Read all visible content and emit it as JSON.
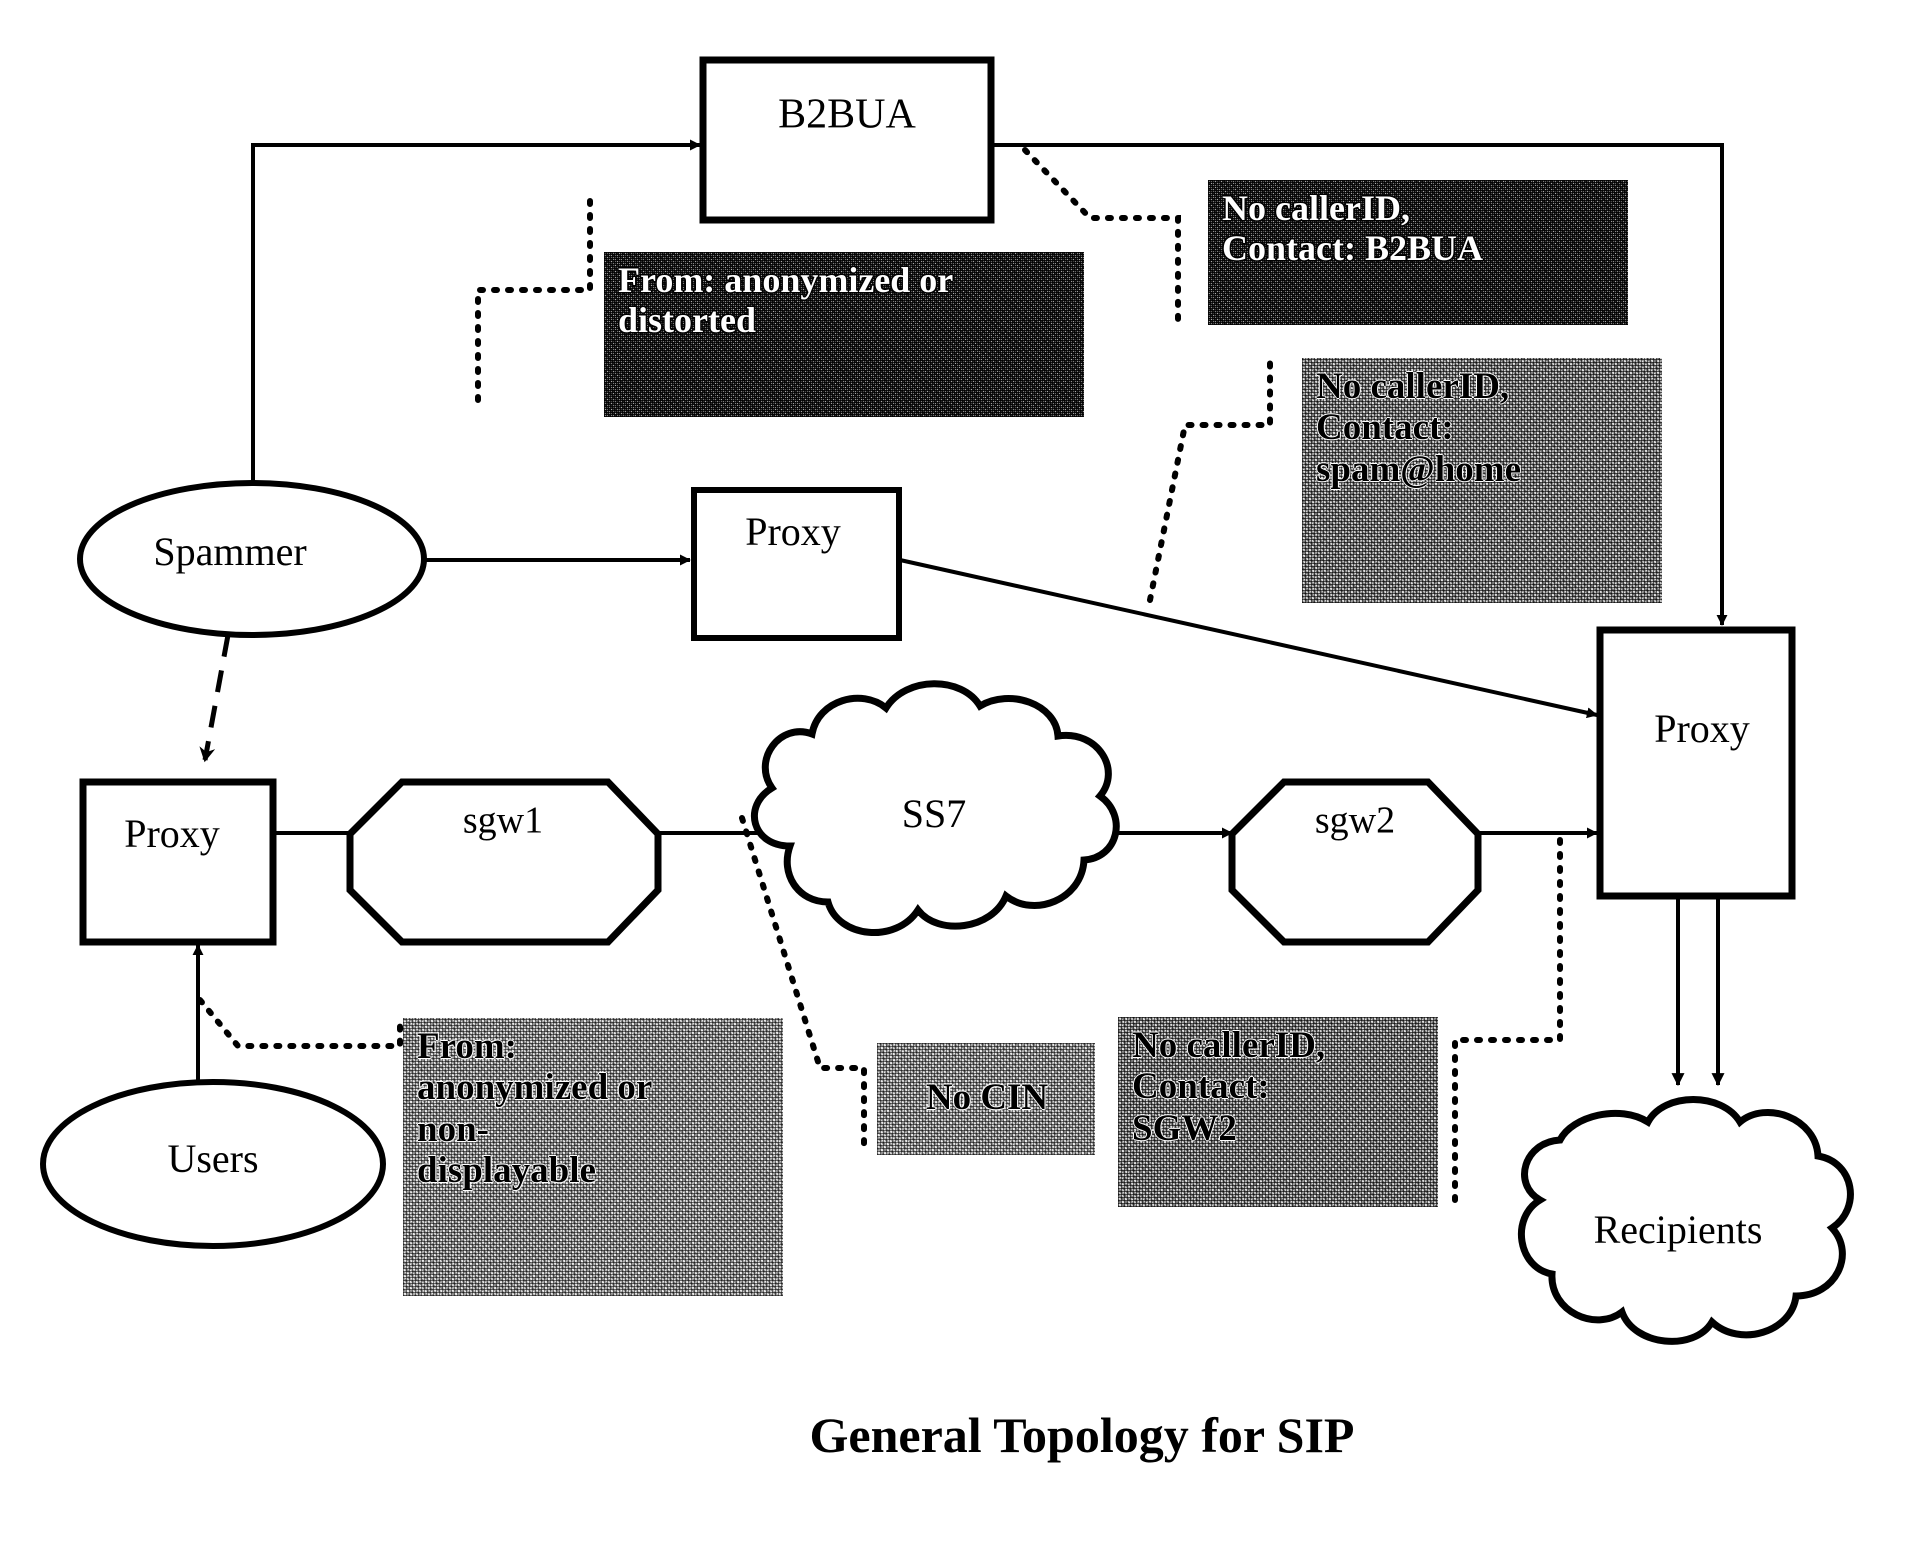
{
  "figure": {
    "caption": "General Topology for SIP"
  },
  "nodes": {
    "b2bua": {
      "label": "B2BUA"
    },
    "spammer": {
      "label": "Spammer"
    },
    "proxy_mid": {
      "label": "Proxy"
    },
    "proxy_right": {
      "label": "Proxy"
    },
    "proxy_left": {
      "label": "Proxy"
    },
    "users": {
      "label": "Users"
    },
    "sgw1": {
      "label": "sgw1"
    },
    "ss7": {
      "label": "SS7"
    },
    "sgw2": {
      "label": "sgw2"
    },
    "recipients": {
      "label": "Recipients"
    }
  },
  "callouts": {
    "b2bua_contact": {
      "style": "dark",
      "lines": [
        "No callerID,",
        "Contact: B2BUA"
      ]
    },
    "from_anon_distorted": {
      "style": "dark",
      "lines": [
        "From: anonymized or",
        "distorted"
      ]
    },
    "spam_home_contact": {
      "style": "mid",
      "lines": [
        "No callerID,",
        "Contact:",
        "spam@home"
      ]
    },
    "from_anon_nondisplayable": {
      "style": "light",
      "lines": [
        "From:",
        "anonymized or",
        "non-",
        "displayable"
      ]
    },
    "no_cin": {
      "style": "light",
      "lines": [
        "No CIN"
      ]
    },
    "sgw2_contact": {
      "style": "mid",
      "lines": [
        "No callerID,",
        "Contact:",
        "SGW2"
      ]
    }
  },
  "colors": {
    "stroke": "#000000",
    "background": "#ffffff",
    "callout_dark": "#6b6b6b",
    "callout_light": "#c9c9c9",
    "callout_mid": "#b5b5b5"
  }
}
